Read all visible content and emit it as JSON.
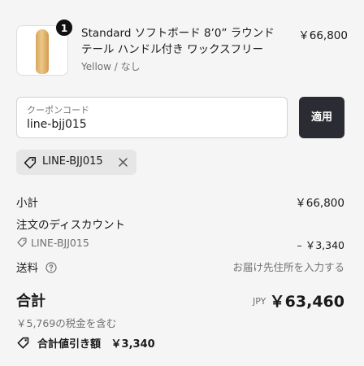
{
  "product": {
    "title_line1": "Standard ソフトボード 8’0” ラウンド",
    "title_line2": "テール ハンドル付き ワックスフリー",
    "variant": "Yellow / なし",
    "price": "￥66,800",
    "quantity": "1",
    "board_color": "#e2b46c"
  },
  "coupon": {
    "label": "クーポンコード",
    "value": "line-bjj015",
    "apply_label": "適用",
    "applied_code": "LINE-BJJ015"
  },
  "summary": {
    "subtotal_label": "小計",
    "subtotal_value": "￥66,800",
    "discount_label": "注文のディスカウント",
    "discount_code": "LINE-BJJ015",
    "discount_value": "– ￥3,340",
    "shipping_label": "送料",
    "shipping_value": "お届け先住所を入力する"
  },
  "total": {
    "label": "合計",
    "currency": "JPY",
    "value": "￥63,460",
    "tax_note": "￥5,769の税金を含む",
    "savings_label": "合計値引き額",
    "savings_value": "￥3,340"
  },
  "colors": {
    "background": "#f5f5f5",
    "button": "#2b2b33",
    "chip": "#e6e6e6"
  }
}
